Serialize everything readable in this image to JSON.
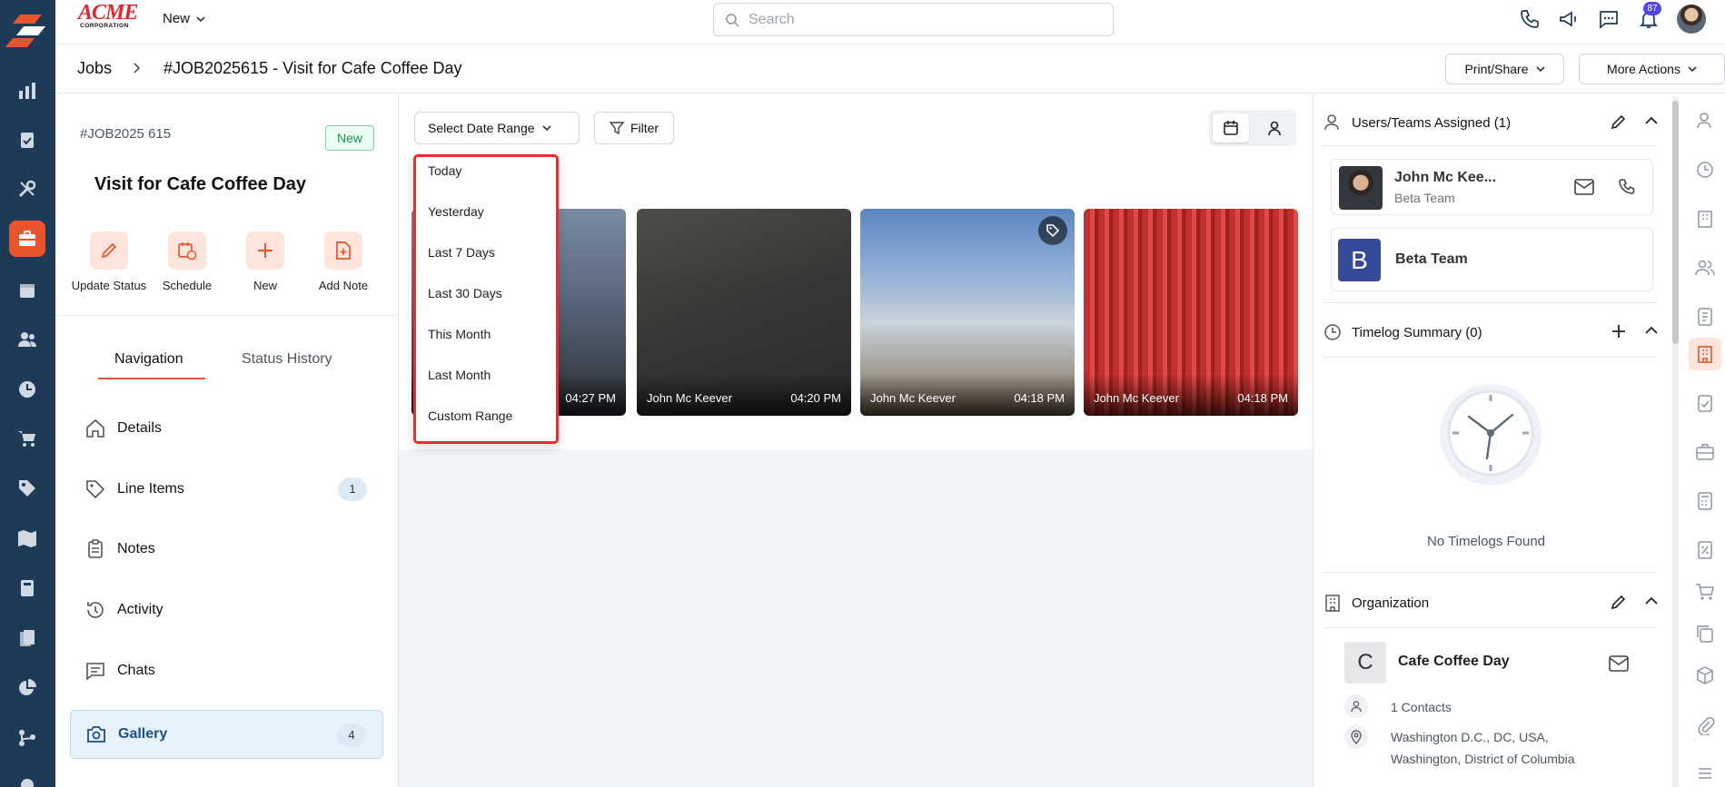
{
  "top": {
    "brand_main": "ACME",
    "brand_sub": "CORPORATION",
    "new_label": "New",
    "search_placeholder": "Search",
    "notification_count": "87"
  },
  "breadcrumb": {
    "jobs": "Jobs",
    "title": "#JOB2025615 - Visit for Cafe Coffee Day",
    "print_share": "Print/Share",
    "more_actions": "More Actions"
  },
  "job": {
    "number": "#JOB2025 615",
    "status": "New",
    "title": "Visit for Cafe Coffee Day"
  },
  "quick_actions": [
    {
      "label": "Update Status"
    },
    {
      "label": "Schedule"
    },
    {
      "label": "New"
    },
    {
      "label": "Add Note"
    }
  ],
  "tabs": {
    "navigation": "Navigation",
    "status_history": "Status History"
  },
  "nav": [
    {
      "label": "Details"
    },
    {
      "label": "Line Items",
      "count": "1"
    },
    {
      "label": "Notes"
    },
    {
      "label": "Activity"
    },
    {
      "label": "Chats"
    },
    {
      "label": "Gallery",
      "count": "4"
    }
  ],
  "gallery": {
    "select_range": "Select Date Range",
    "filter": "Filter",
    "photos": [
      {
        "author": "",
        "time": "04:27 PM"
      },
      {
        "author": "John Mc Keever",
        "time": "04:20 PM"
      },
      {
        "author": "John Mc Keever",
        "time": "04:18 PM"
      },
      {
        "author": "John Mc Keever",
        "time": "04:18 PM"
      }
    ]
  },
  "date_range_options": [
    "Today",
    "Yesterday",
    "Last 7 Days",
    "Last 30 Days",
    "This Month",
    "Last Month",
    "Custom Range"
  ],
  "right": {
    "users_title": "Users/Teams Assigned (1)",
    "user_name": "John Mc Kee...",
    "user_team": "Beta Team",
    "team_initial": "B",
    "team_name": "Beta Team",
    "timelog_title": "Timelog Summary (0)",
    "no_timelogs": "No Timelogs Found",
    "org_title": "Organization",
    "org_initial": "C",
    "org_name": "Cafe Coffee Day",
    "contacts": "1 Contacts",
    "address_line1": "Washington D.C., DC, USA,",
    "address_line2": "Washington, District of Columbia"
  },
  "colors": {
    "rail": "#1e3a56",
    "accent": "#e8542d",
    "active_nav": "#e7f3fc",
    "highlight_border": "#e03131"
  }
}
